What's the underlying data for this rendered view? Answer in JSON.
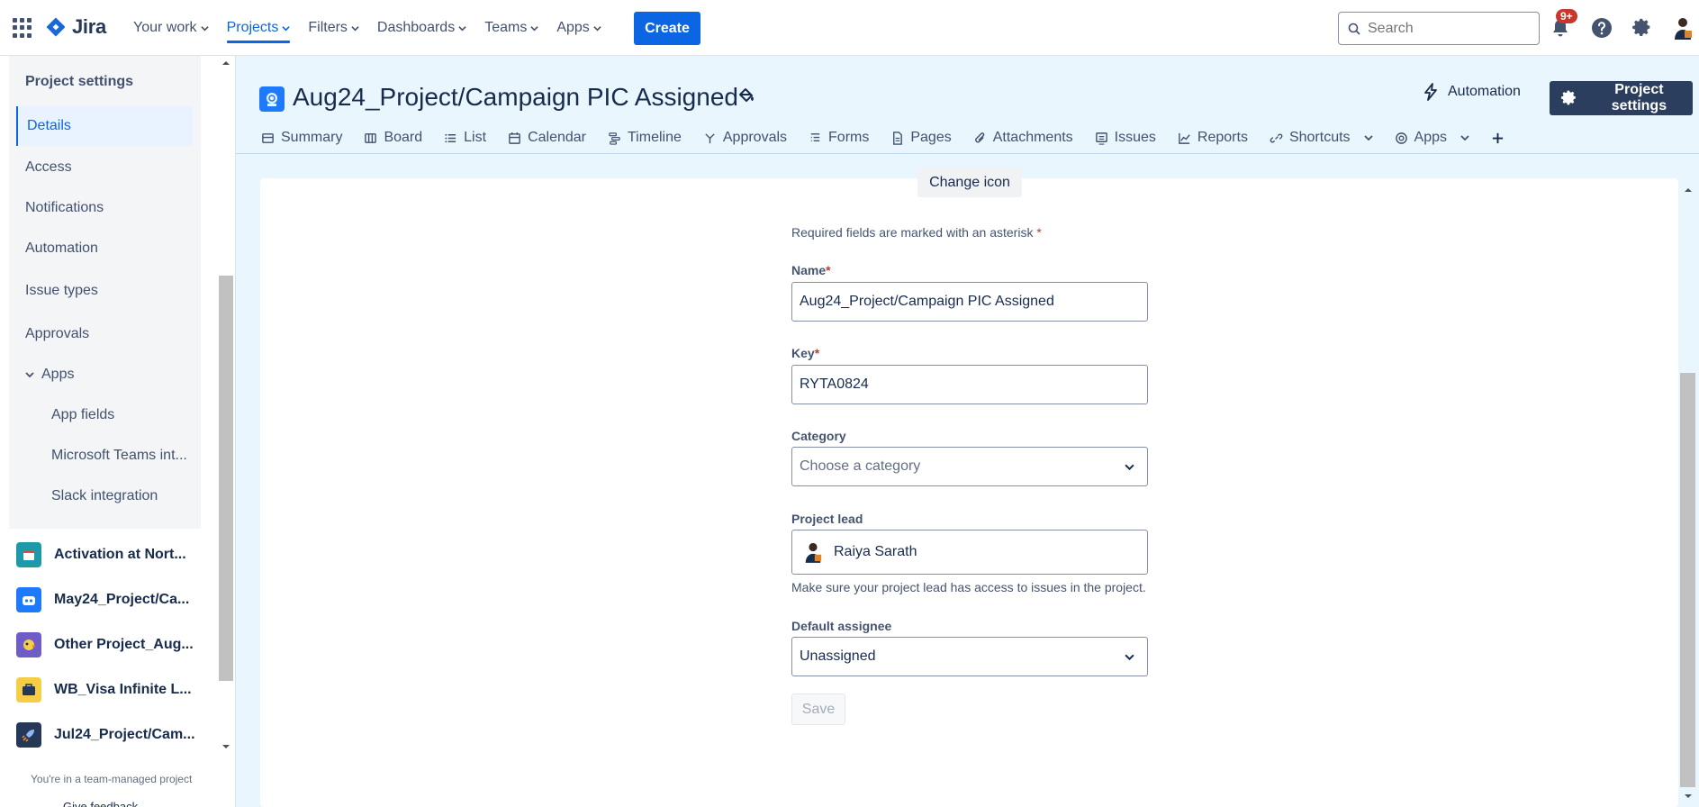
{
  "topnav": {
    "logo_text": "Jira",
    "items": [
      {
        "label": "Your work"
      },
      {
        "label": "Projects"
      },
      {
        "label": "Filters"
      },
      {
        "label": "Dashboards"
      },
      {
        "label": "Teams"
      },
      {
        "label": "Apps"
      }
    ],
    "create_label": "Create",
    "search_placeholder": "Search",
    "notification_badge": "9+"
  },
  "sidebar": {
    "title": "Project settings",
    "items": [
      {
        "label": "Details"
      },
      {
        "label": "Access"
      },
      {
        "label": "Notifications"
      },
      {
        "label": "Automation"
      },
      {
        "label": "Issue types"
      },
      {
        "label": "Approvals"
      },
      {
        "label": "Apps"
      }
    ],
    "app_items": [
      {
        "label": "App fields"
      },
      {
        "label": "Microsoft Teams int..."
      },
      {
        "label": "Slack integration"
      }
    ],
    "projects": [
      {
        "label": "Activation at Nort...",
        "color": "#1d9aaa"
      },
      {
        "label": "May24_Project/Ca...",
        "color": "#1d7afc"
      },
      {
        "label": "Other Project_Aug...",
        "color": "#6e5dc6"
      },
      {
        "label": "WB_Visa Infinite L...",
        "color": "#f5cd47"
      },
      {
        "label": "Jul24_Project/Cam...",
        "color": "#253858"
      }
    ],
    "team_note": "You're in a team-managed project",
    "feedback": "Give feedback"
  },
  "header": {
    "title": "Aug24_Project/Campaign PIC Assigned",
    "automation_label": "Automation",
    "project_settings_label": "Project settings",
    "tabs": [
      {
        "label": "Summary"
      },
      {
        "label": "Board"
      },
      {
        "label": "List"
      },
      {
        "label": "Calendar"
      },
      {
        "label": "Timeline"
      },
      {
        "label": "Approvals"
      },
      {
        "label": "Forms"
      },
      {
        "label": "Pages"
      },
      {
        "label": "Attachments"
      },
      {
        "label": "Issues"
      },
      {
        "label": "Reports"
      },
      {
        "label": "Shortcuts"
      },
      {
        "label": "Apps"
      }
    ]
  },
  "form": {
    "change_icon_label": "Change icon",
    "required_note": "Required fields are marked with an asterisk",
    "asterisk": "*",
    "name_label": "Name",
    "name_value": "Aug24_Project/Campaign PIC Assigned",
    "key_label": "Key",
    "key_value": "RYTA0824",
    "category_label": "Category",
    "category_placeholder": "Choose a category",
    "lead_label": "Project lead",
    "lead_value": "Raiya Sarath",
    "lead_hint": "Make sure your project lead has access to issues in the project.",
    "assignee_label": "Default assignee",
    "assignee_value": "Unassigned",
    "save_label": "Save"
  },
  "colors": {
    "brand_blue": "#0c66e4",
    "header_bg": "#e9f6fd",
    "dark_button": "#2c3e5d",
    "required_red": "#c9372c"
  }
}
